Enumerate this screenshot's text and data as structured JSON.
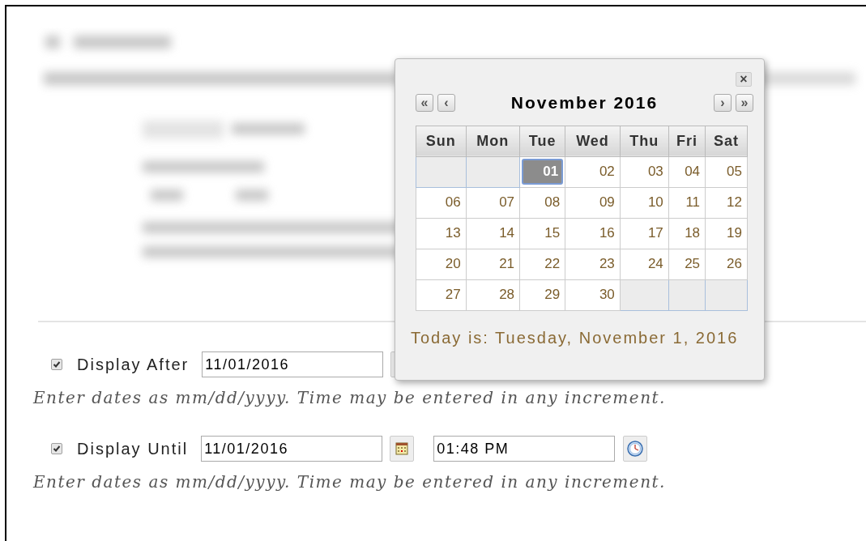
{
  "schedule": [
    {
      "label": "Display After",
      "checked": true,
      "date": "11/01/2016",
      "hint": "Enter dates as mm/dd/yyyy. Time may be entered in any increment."
    },
    {
      "label": "Display Until",
      "checked": true,
      "date": "11/01/2016",
      "time": "01:48 PM",
      "hint": "Enter dates as mm/dd/yyyy. Time may be entered in any increment."
    }
  ],
  "calendar": {
    "close": "×",
    "prev_year": "«",
    "prev_month": "‹",
    "title": "November 2016",
    "next_month": "›",
    "next_year": "»",
    "weekdays": [
      "Sun",
      "Mon",
      "Tue",
      "Wed",
      "Thu",
      "Fri",
      "Sat"
    ],
    "weeks": [
      [
        {
          "kind": "empty"
        },
        {
          "kind": "empty"
        },
        {
          "kind": "day",
          "label": "01",
          "selected": true
        },
        {
          "kind": "day",
          "label": "02",
          "selected": false
        },
        {
          "kind": "day",
          "label": "03",
          "selected": false
        },
        {
          "kind": "day",
          "label": "04",
          "selected": false
        },
        {
          "kind": "day",
          "label": "05",
          "selected": false
        }
      ],
      [
        {
          "kind": "day",
          "label": "06",
          "selected": false
        },
        {
          "kind": "day",
          "label": "07",
          "selected": false
        },
        {
          "kind": "day",
          "label": "08",
          "selected": false
        },
        {
          "kind": "day",
          "label": "09",
          "selected": false
        },
        {
          "kind": "day",
          "label": "10",
          "selected": false
        },
        {
          "kind": "day",
          "label": "11",
          "selected": false
        },
        {
          "kind": "day",
          "label": "12",
          "selected": false
        }
      ],
      [
        {
          "kind": "day",
          "label": "13",
          "selected": false
        },
        {
          "kind": "day",
          "label": "14",
          "selected": false
        },
        {
          "kind": "day",
          "label": "15",
          "selected": false
        },
        {
          "kind": "day",
          "label": "16",
          "selected": false
        },
        {
          "kind": "day",
          "label": "17",
          "selected": false
        },
        {
          "kind": "day",
          "label": "18",
          "selected": false
        },
        {
          "kind": "day",
          "label": "19",
          "selected": false
        }
      ],
      [
        {
          "kind": "day",
          "label": "20",
          "selected": false
        },
        {
          "kind": "day",
          "label": "21",
          "selected": false
        },
        {
          "kind": "day",
          "label": "22",
          "selected": false
        },
        {
          "kind": "day",
          "label": "23",
          "selected": false
        },
        {
          "kind": "day",
          "label": "24",
          "selected": false
        },
        {
          "kind": "day",
          "label": "25",
          "selected": false
        },
        {
          "kind": "day",
          "label": "26",
          "selected": false
        }
      ],
      [
        {
          "kind": "day",
          "label": "27",
          "selected": false
        },
        {
          "kind": "day",
          "label": "28",
          "selected": false
        },
        {
          "kind": "day",
          "label": "29",
          "selected": false
        },
        {
          "kind": "day",
          "label": "30",
          "selected": false
        },
        {
          "kind": "empty"
        },
        {
          "kind": "empty"
        },
        {
          "kind": "empty"
        }
      ]
    ],
    "today": "Today is: Tuesday, November 1, 2016"
  }
}
